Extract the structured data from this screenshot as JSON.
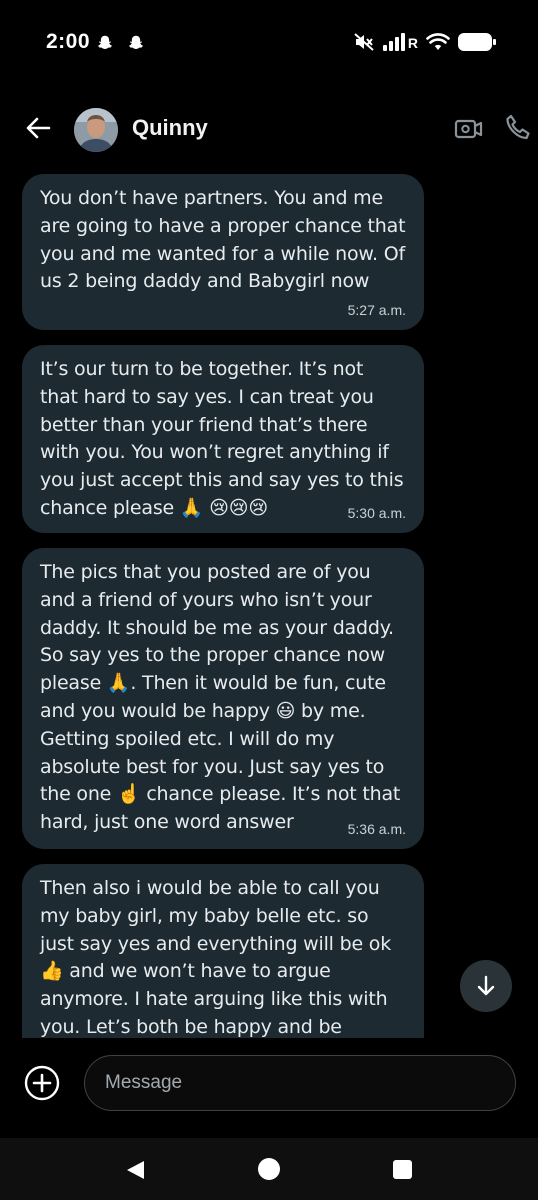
{
  "status_bar": {
    "time": "2:00",
    "signal_label": "R",
    "icons": [
      "snapchat-icon",
      "snapchat-icon",
      "mute-icon",
      "signal-icon",
      "wifi-icon",
      "battery-icon"
    ]
  },
  "header": {
    "contact_name": "Quinny",
    "icons": [
      "back-arrow-icon",
      "video-call-icon",
      "phone-call-icon"
    ]
  },
  "messages": [
    {
      "text": "You don’t have partners. You and me are going to have a proper chance that you and me wanted for a while now. Of us 2 being daddy and Babygirl now",
      "time": "5:27 a.m."
    },
    {
      "text": "It’s our turn to be together. It’s not that hard to say yes. I can treat you better than your friend that’s there with you. You won’t regret anything if you just accept this and say yes to this chance please 🙏 😢😢😢",
      "time": "5:30 a.m."
    },
    {
      "text": "The pics that you posted are of you and a friend of yours who isn’t your daddy. It should be me as your daddy. So say yes to the proper chance now please 🙏. Then it would be fun, cute and you would be happy 😃 by me. Getting spoiled etc. I will do my absolute best for you. Just say yes to the one ☝️ chance please. It’s not that hard, just one word answer",
      "time": "5:36 a.m."
    },
    {
      "text": "Then also i would be able to call you my baby girl, my baby belle etc. so just say yes and everything will be ok 👍 and we won’t have to argue anymore. I hate arguing like this with you. Let’s both be happy and be together finally",
      "time": ""
    }
  ],
  "composer": {
    "placeholder": "Message"
  },
  "colors": {
    "background": "#000000",
    "bubble": "#1e2a31",
    "text": "#e6ebee",
    "timestamp": "#c9d1d6"
  }
}
